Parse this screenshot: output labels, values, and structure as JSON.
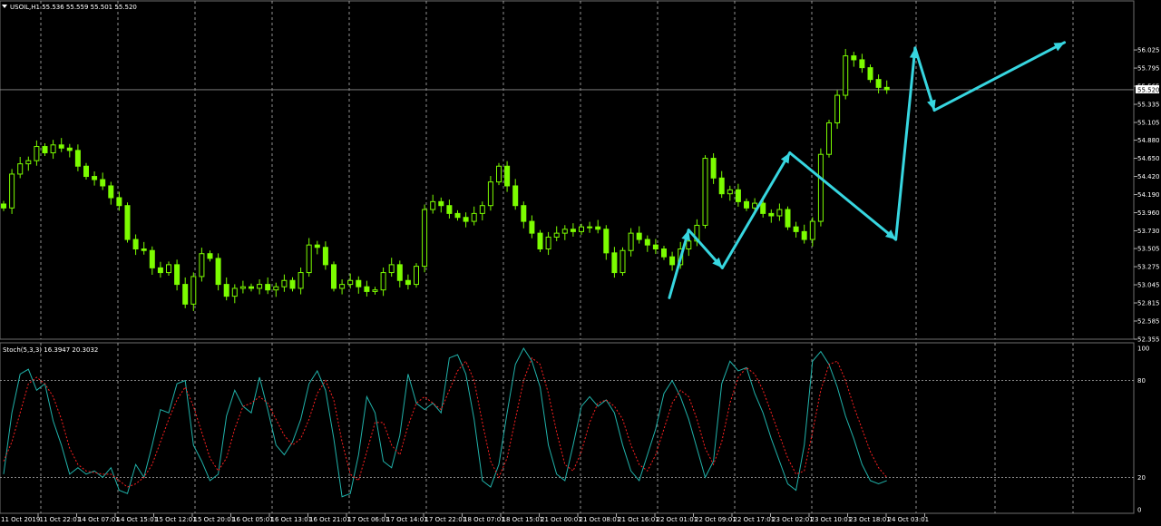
{
  "header": {
    "symbol_info": "USOIL,H1  55.536 55.559 55.501 55.520"
  },
  "indicator": {
    "label": "Stoch(5,3,3) 16.3947 20.3032"
  },
  "colors": {
    "background": "#000000",
    "candle": "#7cfc00",
    "grid": "#b4b4b4",
    "arrow": "#37d6e0",
    "stoch_main": "#20b2aa",
    "stoch_signal": "#ff2020",
    "text": "#ffffff"
  },
  "chart_data": [
    {
      "type": "candlestick",
      "title": "USOIL,H1  55.536 55.559 55.501 55.520",
      "ylim": [
        52.355,
        56.14
      ],
      "y_ticks": [
        "56.025",
        "55.795",
        "55.565",
        "55.335",
        "55.105",
        "54.880",
        "54.650",
        "54.420",
        "54.190",
        "53.960",
        "53.730",
        "53.505",
        "53.275",
        "53.045",
        "52.815",
        "52.585",
        "52.355"
      ],
      "current_price": "55.520",
      "x_ticks": [
        "11 Oct 2019",
        "11 Oct 22:01",
        "14 Oct 07:01",
        "14 Oct 15:01",
        "15 Oct 12:01",
        "15 Oct 20:01",
        "16 Oct 05:01",
        "16 Oct 13:01",
        "16 Oct 21:01",
        "17 Oct 06:01",
        "17 Oct 14:01",
        "17 Oct 22:01",
        "18 Oct 07:01",
        "18 Oct 15:01",
        "21 Oct 00:01",
        "21 Oct 08:01",
        "21 Oct 16:01",
        "22 Oct 01:01",
        "22 Oct 09:01",
        "22 Oct 17:01",
        "23 Oct 02:01",
        "23 Oct 10:01",
        "23 Oct 18:01",
        "24 Oct 03:01"
      ],
      "closes": [
        54.02,
        54.45,
        54.58,
        54.62,
        54.8,
        54.72,
        54.82,
        54.78,
        54.75,
        54.55,
        54.42,
        54.38,
        54.3,
        54.15,
        54.05,
        53.62,
        53.5,
        53.48,
        53.26,
        53.2,
        53.3,
        53.05,
        52.8,
        53.15,
        53.44,
        53.38,
        53.05,
        52.9,
        53.0,
        53.02,
        53.0,
        53.05,
        52.98,
        53.02,
        53.1,
        53.0,
        53.2,
        53.55,
        53.52,
        53.3,
        53.0,
        53.05,
        53.1,
        53.02,
        52.96,
        52.98,
        53.2,
        53.3,
        53.1,
        53.05,
        53.28,
        54.0,
        54.1,
        54.05,
        53.95,
        53.9,
        53.85,
        53.95,
        54.05,
        54.35,
        54.55,
        54.3,
        54.05,
        53.85,
        53.7,
        53.5,
        53.65,
        53.7,
        53.75,
        53.72,
        53.78,
        53.78,
        53.75,
        53.45,
        53.2,
        53.48,
        53.7,
        53.62,
        53.55,
        53.5,
        53.4,
        53.3,
        53.5,
        53.6,
        53.8,
        54.65,
        54.4,
        54.2,
        54.25,
        54.1,
        54.02,
        54.08,
        53.95,
        53.92,
        54.0,
        53.78,
        53.72,
        53.62,
        53.85,
        54.7,
        55.1,
        55.45,
        55.95,
        55.9,
        55.8,
        55.65,
        55.55,
        55.52
      ],
      "arrows": [
        {
          "from": [
            "21 Oct 09:01",
            52.88
          ],
          "to": [
            "21 Oct 13:01",
            53.74
          ]
        },
        {
          "from": [
            "21 Oct 13:01",
            53.74
          ],
          "to": [
            "21 Oct 20:01",
            53.26
          ]
        },
        {
          "from": [
            "21 Oct 20:01",
            53.26
          ],
          "to": [
            "22 Oct 10:01",
            54.72
          ]
        },
        {
          "from": [
            "22 Oct 10:01",
            54.72
          ],
          "to": [
            "23 Oct 08:01",
            53.62
          ]
        },
        {
          "from": [
            "23 Oct 08:01",
            53.62
          ],
          "to": [
            "23 Oct 12:01",
            56.05
          ]
        },
        {
          "from": [
            "23 Oct 12:01",
            56.05
          ],
          "to": [
            "23 Oct 16:01",
            55.26
          ]
        },
        {
          "from": [
            "23 Oct 16:01",
            55.26
          ],
          "to": [
            "24 Oct 19:01",
            56.12
          ]
        }
      ]
    },
    {
      "type": "line",
      "title": "Stoch(5,3,3) 16.3947 20.3032",
      "ylim": [
        0,
        100
      ],
      "y_ticks": [
        "100",
        "80",
        "20",
        "0"
      ],
      "series": [
        {
          "name": "main",
          "values": [
            22,
            60,
            84,
            87,
            74,
            78,
            55,
            40,
            22,
            26,
            22,
            24,
            20,
            26,
            12,
            10,
            28,
            20,
            40,
            62,
            60,
            78,
            80,
            40,
            30,
            18,
            22,
            58,
            74,
            64,
            60,
            82,
            62,
            40,
            34,
            42,
            56,
            78,
            86,
            74,
            44,
            8,
            10,
            34,
            70,
            60,
            30,
            26,
            46,
            84,
            66,
            62,
            66,
            60,
            94,
            96,
            84,
            56,
            18,
            14,
            28,
            60,
            90,
            100,
            92,
            76,
            40,
            22,
            18,
            40,
            64,
            70,
            64,
            68,
            60,
            40,
            24,
            18,
            34,
            50,
            72,
            80,
            70,
            56,
            38,
            20,
            30,
            78,
            92,
            86,
            88,
            72,
            60,
            44,
            30,
            16,
            12,
            40,
            92,
            98,
            90,
            76,
            58,
            44,
            28,
            18,
            16,
            18
          ]
        },
        {
          "name": "signal",
          "values": [
            30,
            42,
            60,
            78,
            82,
            78,
            70,
            56,
            38,
            28,
            24,
            23,
            22,
            22,
            18,
            14,
            16,
            20,
            28,
            42,
            56,
            68,
            76,
            64,
            48,
            32,
            24,
            32,
            50,
            64,
            66,
            70,
            66,
            56,
            46,
            40,
            44,
            56,
            72,
            80,
            68,
            42,
            22,
            18,
            36,
            54,
            54,
            40,
            34,
            52,
            66,
            70,
            66,
            62,
            74,
            86,
            92,
            80,
            54,
            30,
            20,
            32,
            56,
            80,
            94,
            90,
            72,
            48,
            28,
            24,
            36,
            54,
            66,
            68,
            64,
            56,
            40,
            28,
            24,
            34,
            50,
            66,
            74,
            70,
            56,
            38,
            28,
            42,
            66,
            82,
            88,
            84,
            74,
            60,
            46,
            32,
            22,
            24,
            48,
            74,
            90,
            92,
            80,
            64,
            50,
            36,
            26,
            20
          ]
        }
      ],
      "levels": [
        80,
        20
      ]
    }
  ]
}
